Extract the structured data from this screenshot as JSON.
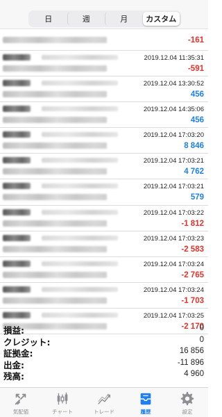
{
  "period_tabs": [
    {
      "label": "日"
    },
    {
      "label": "週"
    },
    {
      "label": "月"
    },
    {
      "label": "カスタム"
    }
  ],
  "active_period": "カスタム",
  "deals": [
    {
      "time": "",
      "profit": "-161",
      "sign": "neg"
    },
    {
      "time": "2019.12.04 11:35:31",
      "profit": "-591",
      "sign": "neg"
    },
    {
      "time": "2019.12.04 13:30:52",
      "profit": "456",
      "sign": "pos"
    },
    {
      "time": "2019.12.04 14:35:06",
      "profit": "456",
      "sign": "pos"
    },
    {
      "time": "2019.12.04 17:03:20",
      "profit": "8 846",
      "sign": "pos"
    },
    {
      "time": "2019.12.04 17:03:21",
      "profit": "4 762",
      "sign": "pos"
    },
    {
      "time": "2019.12.04 17:03:21",
      "profit": "579",
      "sign": "pos"
    },
    {
      "time": "2019.12.04 17:03:22",
      "profit": "-1 812",
      "sign": "neg"
    },
    {
      "time": "2019.12.04 17:03:23",
      "profit": "-2 583",
      "sign": "neg"
    },
    {
      "time": "2019.12.04 17:03:24",
      "profit": "-2 765",
      "sign": "neg"
    },
    {
      "time": "2019.12.04 17:03:24",
      "profit": "-1 703",
      "sign": "neg"
    },
    {
      "time": "2019.12.04 17:03:25",
      "profit": "-2 170",
      "sign": "neg"
    }
  ],
  "summary": [
    {
      "label": "損益:",
      "value": "0"
    },
    {
      "label": "クレジット:",
      "value": "0"
    },
    {
      "label": "証拠金:",
      "value": "16 856"
    },
    {
      "label": "出金:",
      "value": "-11 896"
    },
    {
      "label": "残高:",
      "value": "4 960"
    }
  ],
  "tabbar": [
    {
      "label": "気配値",
      "icon": "quotes-icon"
    },
    {
      "label": "チャート",
      "icon": "chart-icon"
    },
    {
      "label": "トレード",
      "icon": "trade-icon"
    },
    {
      "label": "履歴",
      "icon": "history-icon"
    },
    {
      "label": "設定",
      "icon": "settings-icon"
    }
  ],
  "active_tab": "履歴",
  "colors": {
    "negative": "#e8312a",
    "positive": "#1d7ff0",
    "tab_active": "#1d7ff0",
    "tab_inactive": "#8e8e93"
  }
}
